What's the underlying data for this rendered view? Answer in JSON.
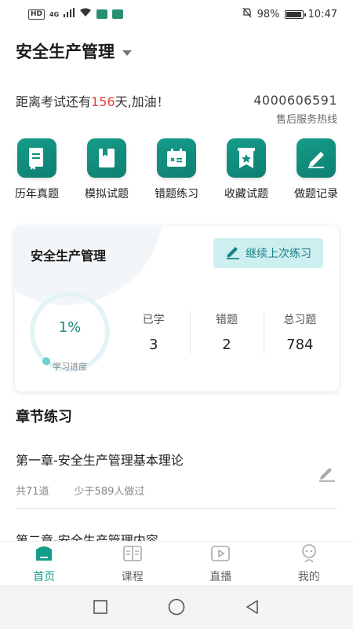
{
  "status_bar": {
    "hd": "HD",
    "network": "4G",
    "battery_text": "98%",
    "battery_level": 0.98,
    "time": "10:47",
    "icons": [
      "hd-icon",
      "signal-icon",
      "wifi-icon",
      "app-notification-icon",
      "mute-bell-icon",
      "battery-icon"
    ]
  },
  "header": {
    "title": "安全生产管理",
    "dropdown_icon": "caret-down-icon"
  },
  "exam": {
    "prefix": "距离考试还有",
    "days": "156",
    "suffix": "天,加油！"
  },
  "hotline": {
    "number": "4000606591",
    "label": "售后服务热线"
  },
  "grid": [
    {
      "label": "历年真题",
      "icon": "past-papers-icon"
    },
    {
      "label": "模拟试题",
      "icon": "mock-exam-icon"
    },
    {
      "label": "错题练习",
      "icon": "wrong-questions-icon"
    },
    {
      "label": "收藏试题",
      "icon": "favorites-icon"
    },
    {
      "label": "做题记录",
      "icon": "records-icon"
    }
  ],
  "progress_card": {
    "title": "安全生产管理",
    "continue_label": "继续上次练习",
    "progress_text": "1%",
    "progress_value": 0.01,
    "progress_label": "学习进度",
    "stats": [
      {
        "label": "已学",
        "value": "3"
      },
      {
        "label": "错题",
        "value": "2"
      },
      {
        "label": "总习题",
        "value": "784"
      }
    ]
  },
  "chapters": {
    "section_title": "章节练习",
    "items": [
      {
        "title": "第一章-安全生产管理基本理论",
        "count": "共71道",
        "done": "少于589人做过"
      },
      {
        "title": "第二章-安全生产管理内容"
      }
    ]
  },
  "tabs": [
    {
      "label": "首页",
      "icon": "home-icon",
      "active": true
    },
    {
      "label": "课程",
      "icon": "book-icon",
      "active": false
    },
    {
      "label": "直播",
      "icon": "live-play-icon",
      "active": false
    },
    {
      "label": "我的",
      "icon": "profile-icon",
      "active": false
    }
  ],
  "colors": {
    "accent": "#159c8a",
    "days_red": "#e0413a",
    "continue_bg": "#cdeff0"
  }
}
